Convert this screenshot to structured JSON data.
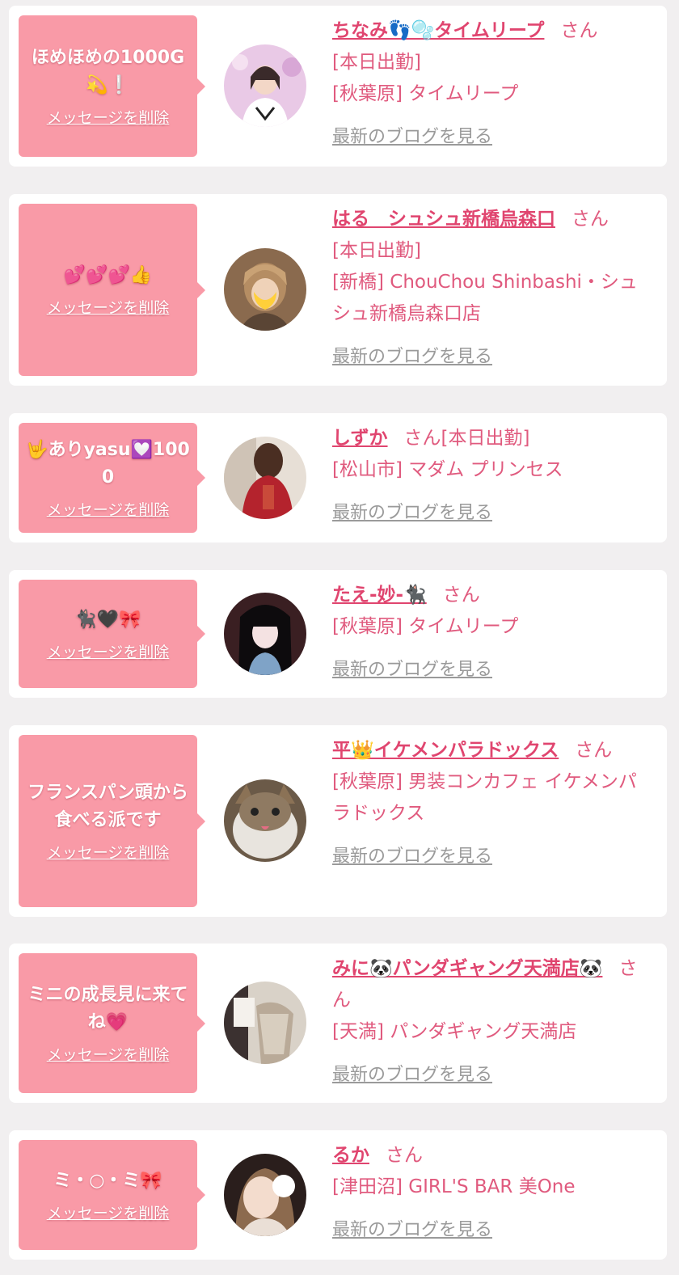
{
  "delete_label": "メッセージを削除",
  "blog_label": "最新のブログを見る",
  "cards": [
    {
      "message": "ほめほめの1000G💫❕",
      "name": "ちなみ👣🫧タイムリープ",
      "honorific": "さん",
      "status": "[本日出勤]",
      "shop": "[秋葉原] タイムリープ"
    },
    {
      "message": "💕💕💕👍",
      "name": "はる　シュシュ新橋烏森口",
      "honorific": "さん",
      "status": "[本日出勤]",
      "shop": "[新橋] ChouChou Shinbashi・シュシュ新橋烏森口店"
    },
    {
      "message": "🤟ありyasu💟1000",
      "name": "しずか",
      "honorific": "さん",
      "status": "[本日出勤]",
      "shop": "[松山市] マダム プリンセス"
    },
    {
      "message": "🐈‍⬛🖤🎀",
      "name": "たえ-妙-🐈‍⬛",
      "honorific": "さん",
      "status": "",
      "shop": "[秋葉原] タイムリープ"
    },
    {
      "message": "フランスパン頭から食べる派です",
      "name": "平👑イケメンパラドックス",
      "honorific": "さん",
      "status": "",
      "shop": "[秋葉原] 男装コンカフェ イケメンパラドックス"
    },
    {
      "message": "ミニの成長見に来てね💗",
      "name": "みに🐼パンダギャング天満店🐼",
      "honorific": "さん",
      "status": "",
      "shop": "[天満] パンダギャング天満店"
    },
    {
      "message": "ミ・○・ミ🎀",
      "name": "るか",
      "honorific": "さん",
      "status": "",
      "shop": "[津田沼] GIRL'S BAR 美One"
    }
  ]
}
